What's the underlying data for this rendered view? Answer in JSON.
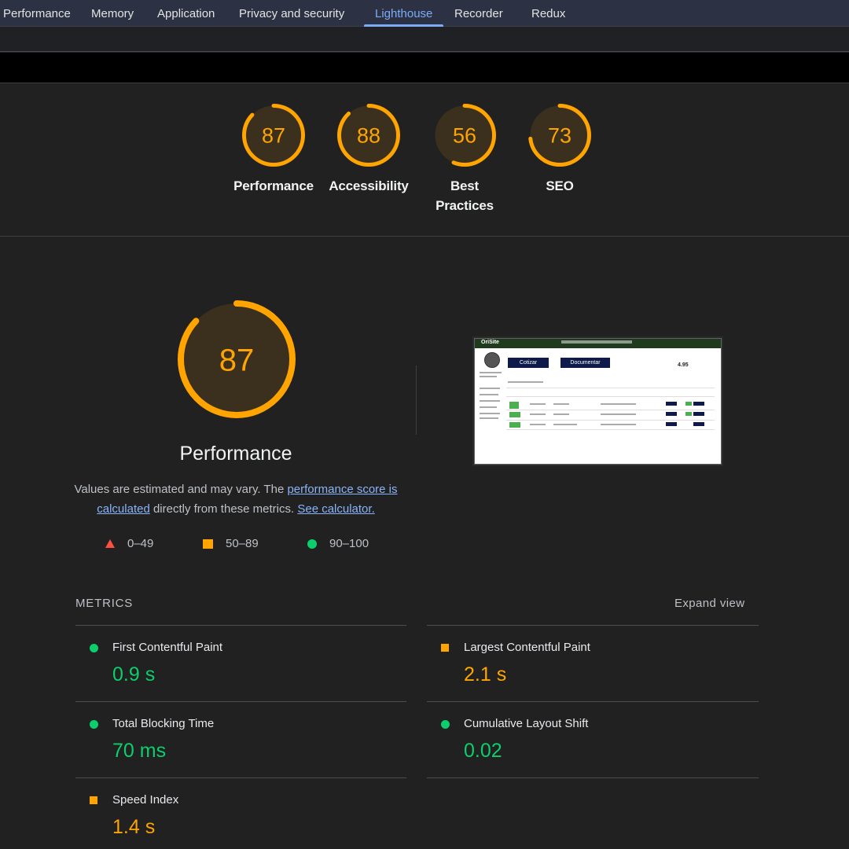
{
  "tabs": [
    "Performance",
    "Memory",
    "Application",
    "Privacy and security",
    "Lighthouse",
    "Recorder",
    "Redux"
  ],
  "active_tab": "Lighthouse",
  "categories": [
    {
      "score": 87,
      "label": "Performance"
    },
    {
      "score": 88,
      "label": "Accessibility"
    },
    {
      "score": 56,
      "label": "Best Practices"
    },
    {
      "score": 73,
      "label": "SEO"
    }
  ],
  "performance": {
    "score": 87,
    "title": "Performance",
    "desc_prefix": "Values are estimated and may vary. The ",
    "desc_link1": "performance score is calculated",
    "desc_mid": " directly from these metrics. ",
    "desc_link2": "See calculator."
  },
  "legend": [
    {
      "range": "0–49",
      "shape": "triangle",
      "color": "#ff4e42"
    },
    {
      "range": "50–89",
      "shape": "square",
      "color": "#ffa400"
    },
    {
      "range": "90–100",
      "shape": "circle",
      "color": "#0cce6b"
    }
  ],
  "screenshot": {
    "logo": "OriSite",
    "btn1": "Cotizar",
    "btn2": "Documentar",
    "rating": "4.95"
  },
  "metrics_header": "METRICS",
  "expand_label": "Expand view",
  "metrics": [
    {
      "name": "First Contentful Paint",
      "value": "0.9 s",
      "status": "good"
    },
    {
      "name": "Largest Contentful Paint",
      "value": "2.1 s",
      "status": "average"
    },
    {
      "name": "Total Blocking Time",
      "value": "70 ms",
      "status": "good"
    },
    {
      "name": "Cumulative Layout Shift",
      "value": "0.02",
      "status": "good"
    },
    {
      "name": "Speed Index",
      "value": "1.4 s",
      "status": "average"
    }
  ],
  "colors": {
    "good": "#0cce6b",
    "average": "#ffa400",
    "fail": "#ff4e42",
    "accent": "#7cacf8"
  }
}
